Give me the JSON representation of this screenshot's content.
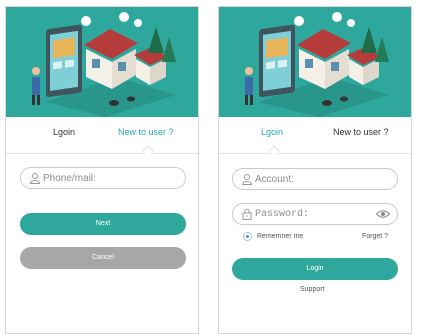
{
  "left": {
    "tabs": {
      "login": "Lgoin",
      "new_user": "New to user ?"
    },
    "phone": {
      "placeholder": "Phone/mail:"
    },
    "next_label": "Next",
    "cancel_label": "Cancel"
  },
  "right": {
    "tabs": {
      "login": "Lgoin",
      "new_user": "New to user ?"
    },
    "account": {
      "placeholder": "Account:"
    },
    "password": {
      "placeholder": "Password:"
    },
    "remember_label": "Rememner me",
    "forget_label": "Forget ?",
    "login_label": "Login",
    "support_label": "Support"
  },
  "colors": {
    "teal": "#2ea89c",
    "accent_text": "#2aa6b8",
    "gray_button": "#a7a7a7"
  },
  "icons": [
    "smart-home-illustration",
    "user-icon",
    "lock-icon",
    "eye-icon",
    "radio-selected-icon"
  ]
}
